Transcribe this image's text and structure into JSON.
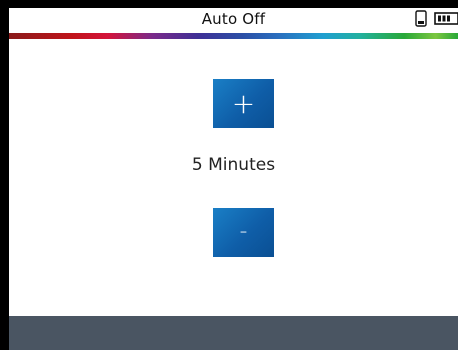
{
  "header": {
    "title": "Auto Off",
    "phone_icon": "phone-icon",
    "battery_icon": "battery-icon"
  },
  "controls": {
    "increase_label": "+",
    "decrease_label": "-",
    "value": "5 Minutes"
  },
  "colors": {
    "button": "#0f5ea8",
    "footer": "#4a5562",
    "frame": "#000000"
  }
}
